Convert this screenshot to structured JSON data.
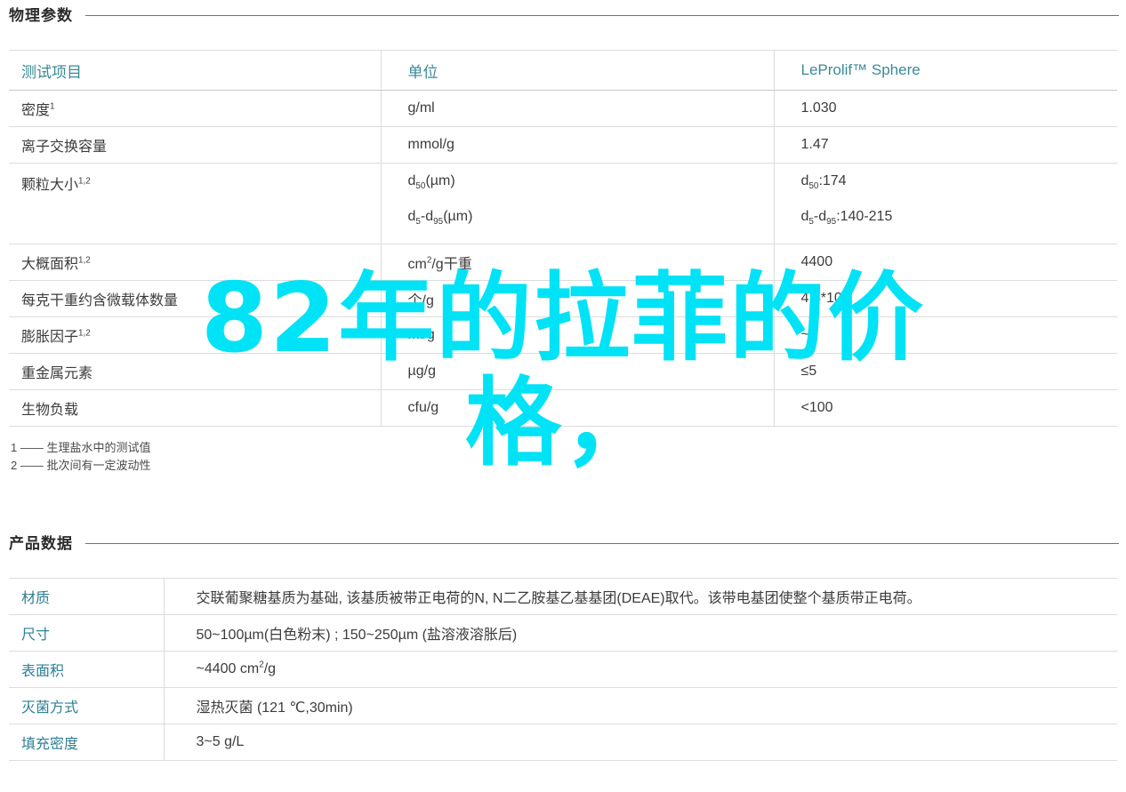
{
  "sections": {
    "physical": {
      "heading": "物理参数",
      "table": {
        "headers": [
          "测试项目",
          "单位",
          "LeProlif™ Sphere"
        ],
        "rows": [
          {
            "item": "密度",
            "item_sup": "1",
            "unit": "g/ml",
            "value": "1.030"
          },
          {
            "item": "离子交换容量",
            "item_sup": "",
            "unit": "mmol/g",
            "value": "1.47"
          },
          {
            "item": "颗粒大小",
            "item_sup": "1,2",
            "unit_lines": [
              "d50(µm)",
              "d5-d95(µm)"
            ],
            "value_lines": [
              "d50:174",
              "d5-d95:140-215"
            ]
          },
          {
            "item": "大概面积",
            "item_sup": "1,2",
            "unit": "cm²/g干重",
            "value": "4400"
          },
          {
            "item": "每克干重约含微载体数量",
            "item_sup": "",
            "unit": "个/g",
            "value": "4.4*10⁶"
          },
          {
            "item": "膨胀因子",
            "item_sup": "1,2",
            "unit": "ml/g",
            "value": "~7"
          },
          {
            "item": "重金属元素",
            "item_sup": "",
            "unit": "µg/g",
            "value": "≤5"
          },
          {
            "item": "生物负载",
            "item_sup": "",
            "unit": "cfu/g",
            "value": "<100"
          }
        ]
      },
      "footnotes": [
        "1 —— 生理盐水中的测试值",
        "2 —— 批次间有一定波动性"
      ]
    },
    "product": {
      "heading": "产品数据",
      "rows": [
        {
          "label": "材质",
          "value": "交联葡聚糖基质为基础, 该基质被带正电荷的N, N二乙胺基乙基基团(DEAE)取代。该带电基团使整个基质带正电荷。"
        },
        {
          "label": "尺寸",
          "value": "50~100µm(白色粉末) ; 150~250µm (盐溶液溶胀后)"
        },
        {
          "label": "表面积",
          "value": "~4400 cm²/g"
        },
        {
          "label": "灭菌方式",
          "value": "湿热灭菌 (121 ℃,30min)"
        },
        {
          "label": "填充密度",
          "value": "3~5 g/L"
        }
      ]
    }
  },
  "watermark": {
    "line1": "82年的拉菲的价",
    "line2": "格，",
    "color": "#00E2F5"
  },
  "colors": {
    "accent": "#3a8a96",
    "label": "#2f7f94",
    "text": "#3c3c3c",
    "rule": "#dcdcdc"
  }
}
